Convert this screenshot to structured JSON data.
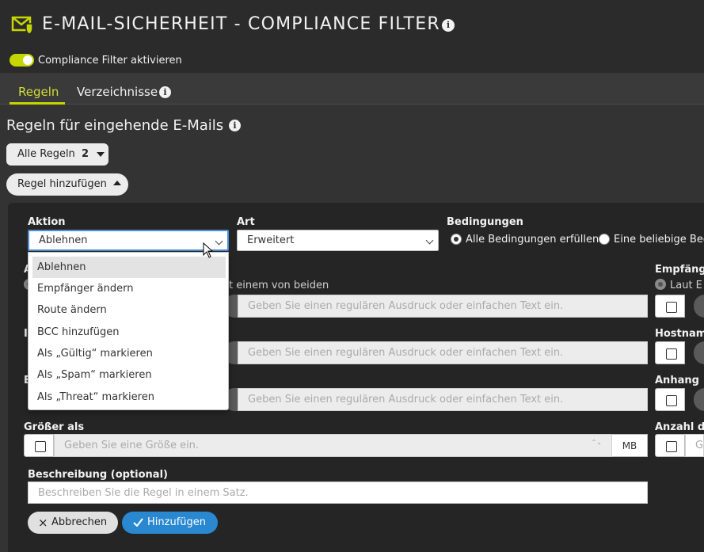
{
  "header": {
    "title": "E-MAIL-SICHERHEIT - COMPLIANCE FILTER",
    "info": "i",
    "toggle_label": "Compliance Filter aktivieren",
    "toggle_on": true,
    "accent_color": "#c6d600"
  },
  "tabs": [
    {
      "label": "Regeln",
      "active": true
    },
    {
      "label": "Verzeichnisse",
      "active": false
    }
  ],
  "section": {
    "title": "Regeln für eingehende E-Mails",
    "all_rules_label": "Alle Regeln",
    "all_rules_count": "2",
    "add_rule_label": "Regel hinzufügen"
  },
  "form": {
    "aktion": {
      "label": "Aktion",
      "value": "Ablehnen",
      "options": [
        "Ablehnen",
        "Empfänger ändern",
        "Route ändern",
        "BCC hinzufügen",
        "Als „Gültig“ markieren",
        "Als „Spam“ markieren",
        "Als „Threat“ markieren"
      ]
    },
    "art": {
      "label": "Art",
      "value": "Erweitert"
    },
    "bedingungen": {
      "label": "Bedingungen",
      "opt_all": "Alle Bedingungen erfüllen",
      "opt_any": "Eine beliebige Bed"
    },
    "partial_left_a": "A",
    "partial_text_beiden": "t einem von beiden",
    "partial_left_i": "I",
    "partial_left_e": "E",
    "regex_placeholder": "Geben Sie einen regulären Ausdruck oder einfachen Text ein.",
    "right_labels": {
      "empfaenger": "Empfänge",
      "laut": "Laut E",
      "hostname": "Hostname",
      "anhang": "Anhang",
      "anzahl": "Anzahl de",
      "anzahl_placeholder": "G"
    },
    "groesser": {
      "label": "Größer als",
      "placeholder": "Geben Sie eine Größe ein.",
      "unit": "MB",
      "stepper": "⌃⌄"
    },
    "beschreibung": {
      "label": "Beschreibung (optional)",
      "placeholder": "Beschreiben Sie die Regel in einem Satz."
    },
    "cancel_label": "Abbrechen",
    "add_label": "Hinzufügen",
    "cancel_icon": "×",
    "primary_color": "#2a88d0"
  }
}
